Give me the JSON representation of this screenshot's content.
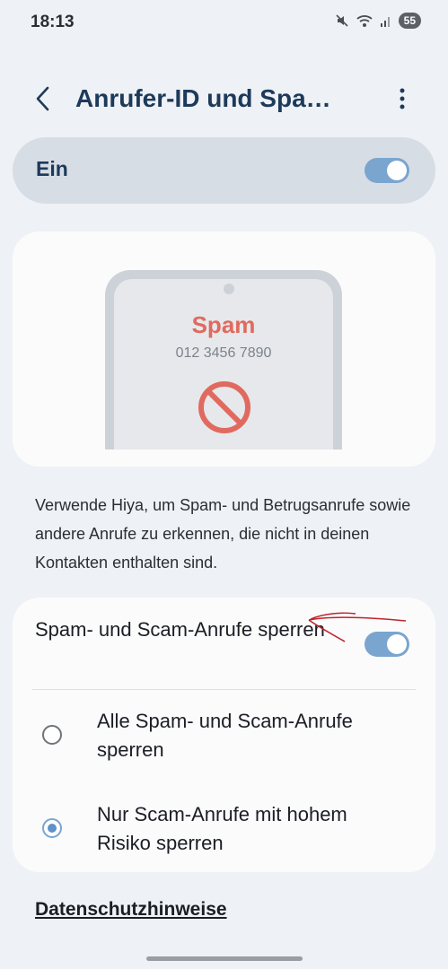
{
  "status_bar": {
    "time": "18:13",
    "battery": "55",
    "icons": [
      "mute-icon",
      "wifi-icon",
      "signal-icon",
      "battery-icon"
    ]
  },
  "header": {
    "title": "Anrufer-ID und Spa…",
    "back_icon": "back-arrow-icon",
    "more_icon": "more-vertical-icon"
  },
  "master_toggle": {
    "label": "Ein",
    "on": true
  },
  "illustration": {
    "spam_label": "Spam",
    "phone_number": "012 3456 7890",
    "icon": "block-icon"
  },
  "description": "Verwende Hiya, um Spam- und Betrugsanrufe sowie andere Anrufe zu erkennen, die nicht in deinen Kontakten enthalten sind.",
  "block_section": {
    "label": "Spam- und Scam-Anrufe sperren",
    "on": true,
    "options": [
      {
        "label": "Alle Spam- und Scam-Anrufe sperren",
        "selected": false
      },
      {
        "label": "Nur Scam-Anrufe mit hohem Risiko sperren",
        "selected": true
      }
    ]
  },
  "privacy_link": "Datenschutzhinweise",
  "colors": {
    "accent": "#7aa5cf",
    "title": "#1d3a5a",
    "spam_red": "#e06a5f",
    "annotation": "#c0242a"
  }
}
